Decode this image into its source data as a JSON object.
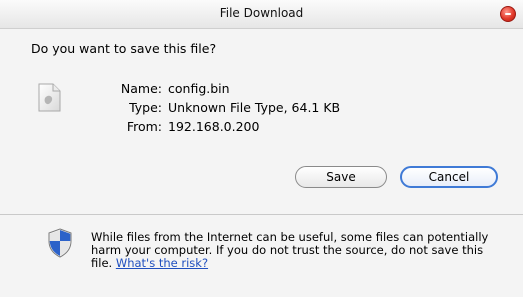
{
  "window": {
    "title": "File Download"
  },
  "dialog": {
    "question": "Do you want to save this file?",
    "file": {
      "icon": "document-icon",
      "labels": [
        "Name:",
        "Type:",
        "From:"
      ],
      "values": [
        "config.bin",
        "Unknown File Type, 64.1 KB",
        "192.168.0.200"
      ]
    },
    "buttons": {
      "save": "Save",
      "cancel": "Cancel"
    },
    "warning": {
      "icon": "shield-icon",
      "text": "While files from the Internet can be useful, some files can potentially harm your computer. If you do not trust the source, do not save this file. ",
      "link": "What's the risk?"
    }
  }
}
